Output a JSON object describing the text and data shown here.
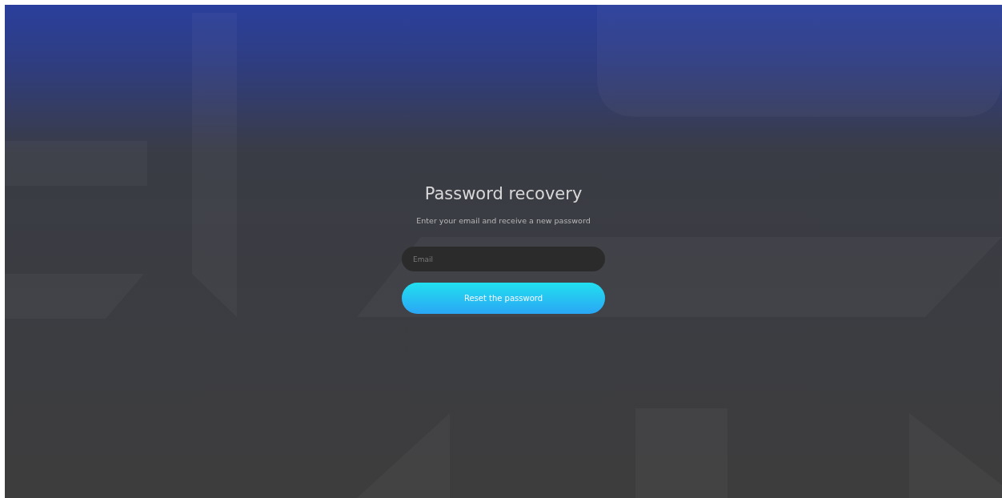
{
  "title": "Password recovery",
  "subtitle": "Enter your email and receive a new password",
  "email_field": {
    "placeholder": "Email"
  },
  "submit_button": {
    "label": "Reset the password"
  }
}
